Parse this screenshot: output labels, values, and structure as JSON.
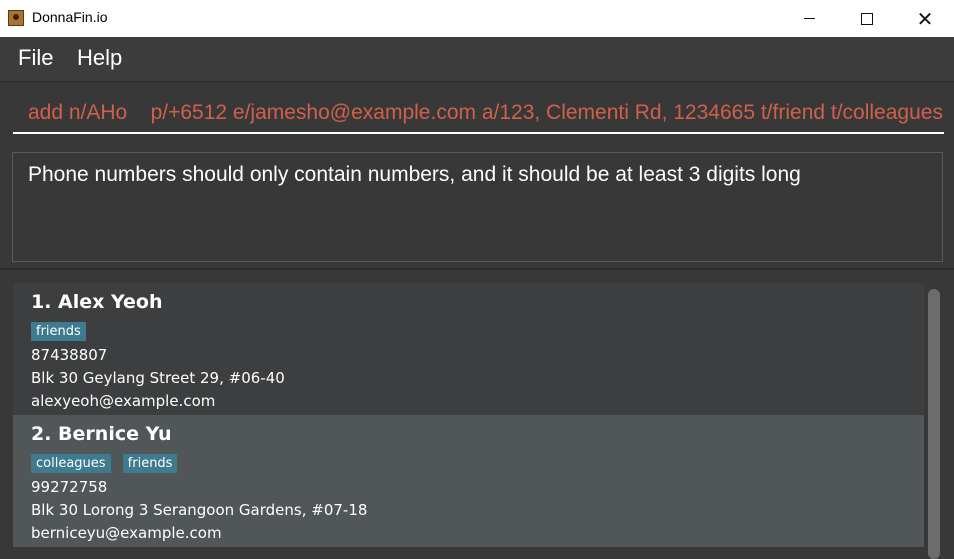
{
  "window": {
    "title": "DonnaFin.io",
    "icon": "app-icon",
    "controls": [
      "minimize-icon",
      "maximize-icon",
      "close-icon"
    ]
  },
  "menu": {
    "file": "File",
    "help": "Help"
  },
  "command": {
    "value": "add n/AHo    p/+6512 e/jamesho@example.com a/123, Clementi Rd, 1234665 t/friend t/colleagues",
    "text_color": "#d0604c"
  },
  "result": {
    "message": "Phone numbers should only contain numbers, and it should be at least 3 digits long"
  },
  "persons": [
    {
      "name": "1.  Alex Yeoh",
      "tags": [
        "friends"
      ],
      "phone": "87438807",
      "address": "Blk 30 Geylang Street 29, #06-40",
      "email": "alexyeoh@example.com"
    },
    {
      "name": "2.  Bernice Yu",
      "tags": [
        "colleagues",
        "friends"
      ],
      "phone": "99272758",
      "address": "Blk 30 Lorong 3 Serangoon Gardens, #07-18",
      "email": "berniceyu@example.com"
    }
  ],
  "colors": {
    "background": "#383838",
    "tag": "#3e7b91",
    "selected_card": "#515658"
  }
}
